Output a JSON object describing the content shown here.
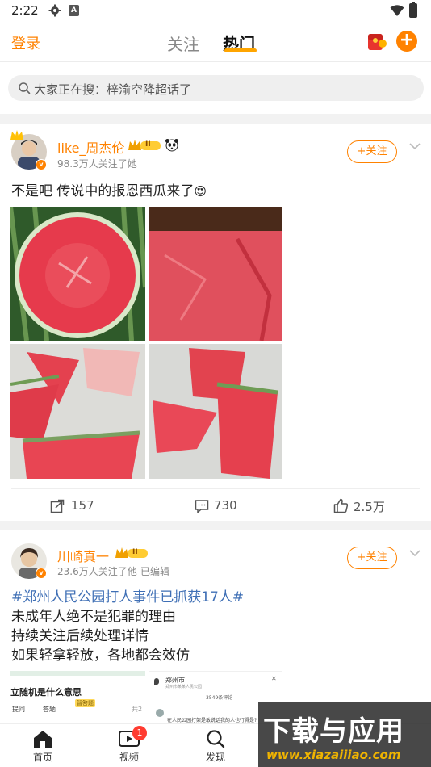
{
  "status_bar": {
    "time": "2:22"
  },
  "top_nav": {
    "login": "登录",
    "tab_follow": "关注",
    "tab_hot": "热门",
    "plus": "+"
  },
  "search": {
    "placeholder": "大家正在搜：梓渝空降超话了"
  },
  "posts": [
    {
      "username": "like_周杰伦",
      "level": "II",
      "meta": "98.3万人关注了她",
      "follow_label": "+关注",
      "text": "不是吧 传说中的报恩西瓜来了",
      "emoji": "😍",
      "repost_count": "157",
      "comment_count": "730",
      "like_count": "2.5万"
    },
    {
      "username": "川崎真一",
      "level": "II",
      "meta": "23.6万人关注了他",
      "edited": "已编辑",
      "follow_label": "+关注",
      "hashtag": "#郑州人民公园打人事件已抓获17人#",
      "lines": [
        "未成年人绝不是犯罪的理由",
        "持续关注后续处理详情",
        "如果轻拿轻放，各地都会效仿"
      ],
      "preview_left_title": "立随机是什么意思",
      "preview_left_chip1": "提问",
      "preview_left_chip2": "答题",
      "preview_left_badge": "智答题",
      "preview_left_right": "共2",
      "preview_right_title": "郑州市",
      "preview_right_sub": "郑州市某某人民公园",
      "preview_right_mid": "3549条评论",
      "preview_right_comment": "在人民公园打架是敢说话我的人也行得是?"
    }
  ],
  "tab_bar": {
    "home": "首页",
    "video": "视频",
    "video_badge": "1",
    "discover": "发现"
  },
  "watermark": {
    "big": "下载与应用",
    "small": "www.xiazaiiiao.com"
  },
  "colors": {
    "accent": "#ff8200",
    "hot_underline": "#ffa500",
    "badge_red": "#ff3b30"
  }
}
